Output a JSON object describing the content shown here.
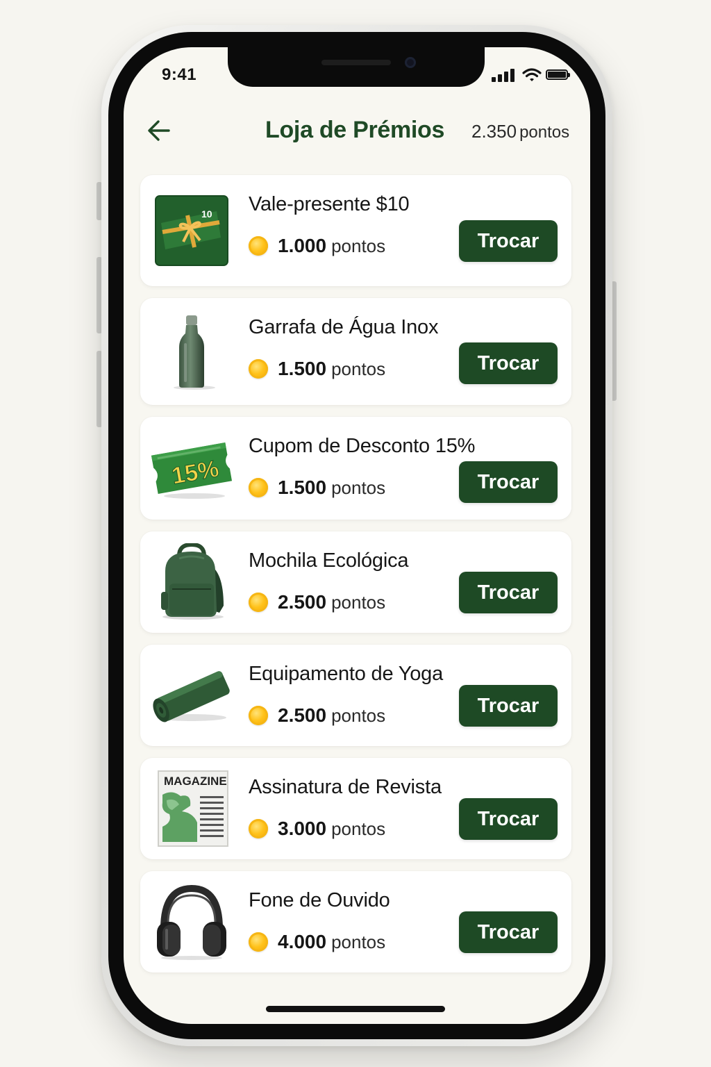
{
  "status_bar": {
    "time": "9:41"
  },
  "header": {
    "title": "Loja de Prémios",
    "points_value": "2.350",
    "points_unit": "pontos",
    "back_icon": "arrow-left-icon"
  },
  "colors": {
    "primary_green": "#1e4a25",
    "title_green": "#1f4a26",
    "coin_gold": "#ffc21a",
    "background": "#f8f7f1"
  },
  "rewards": [
    {
      "name": "Vale-presente $10",
      "price": "1.000",
      "unit": "pontos",
      "button": "Trocar",
      "icon": "gift-card-icon",
      "badge": "10"
    },
    {
      "name": "Garrafa de Água Inox",
      "price": "1.500",
      "unit": "pontos",
      "button": "Trocar",
      "icon": "water-bottle-icon"
    },
    {
      "name": "Cupom de Desconto 15%",
      "price": "1.500",
      "unit": "pontos",
      "button": "Trocar",
      "icon": "coupon-icon",
      "badge": "15%"
    },
    {
      "name": "Mochila Ecológica",
      "price": "2.500",
      "unit": "pontos",
      "button": "Trocar",
      "icon": "backpack-icon"
    },
    {
      "name": "Equipamento de Yoga",
      "price": "2.500",
      "unit": "pontos",
      "button": "Trocar",
      "icon": "yoga-mat-icon"
    },
    {
      "name": "Assinatura de Revista",
      "price": "3.000",
      "unit": "pontos",
      "button": "Trocar",
      "icon": "magazine-icon",
      "badge": "MAGAZINE"
    },
    {
      "name": "Fone de Ouvido",
      "price": "4.000",
      "unit": "pontos",
      "button": "Trocar",
      "icon": "headphones-icon"
    }
  ]
}
